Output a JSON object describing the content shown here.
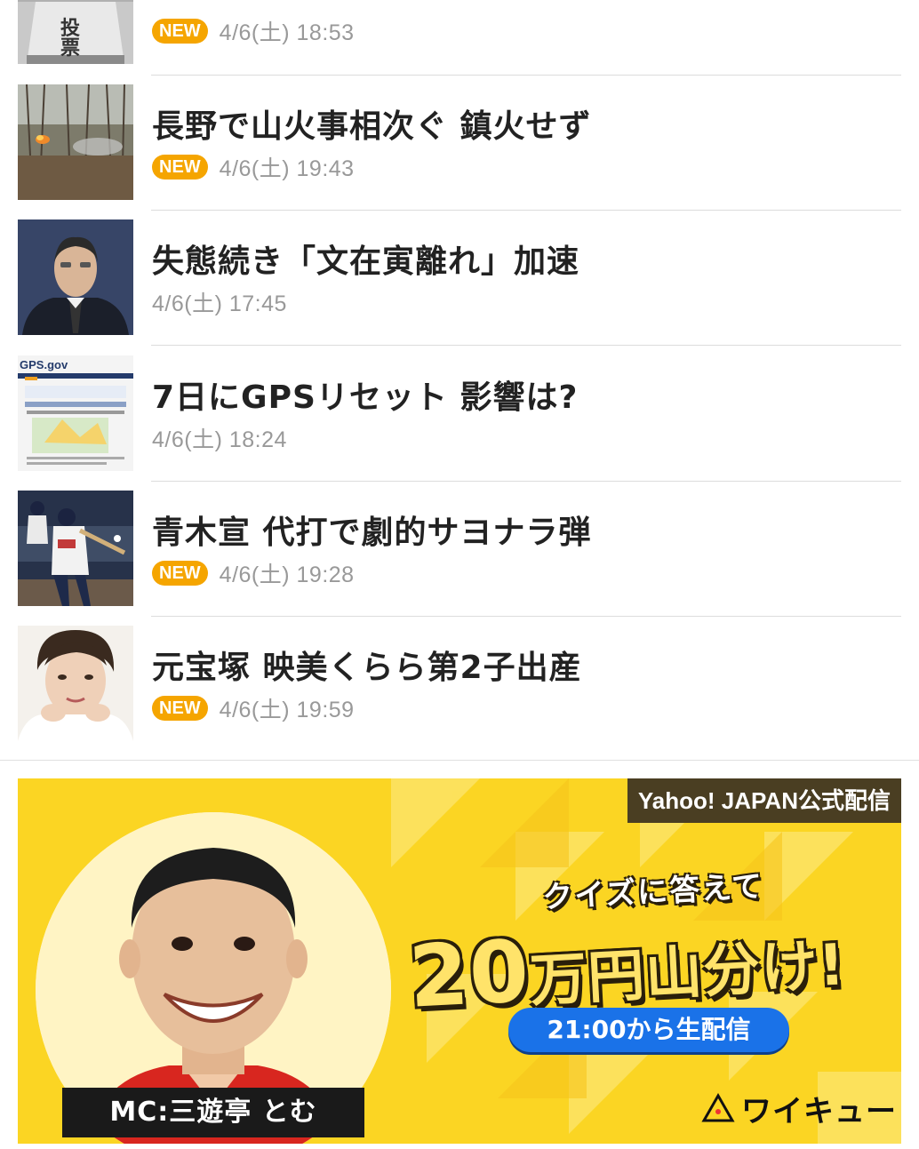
{
  "news": [
    {
      "title": "",
      "badge": "NEW",
      "date": "4/6(土) 18:53",
      "thumb_icon": "ballot-box-icon",
      "thumb_text": "投票"
    },
    {
      "title": "長野で山火事相次ぐ 鎮火せず",
      "badge": "NEW",
      "date": "4/6(土) 19:43",
      "thumb_icon": "wildfire-photo"
    },
    {
      "title": "失態続き「文在寅離れ」加速",
      "badge": "",
      "date": "4/6(土) 17:45",
      "thumb_icon": "politician-photo"
    },
    {
      "title": "7日にGPSリセット 影響は?",
      "badge": "",
      "date": "4/6(土) 18:24",
      "thumb_icon": "gps-website-screenshot",
      "thumb_text": "GPS.gov"
    },
    {
      "title": "青木宣 代打で劇的サヨナラ弾",
      "badge": "NEW",
      "date": "4/6(土) 19:28",
      "thumb_icon": "baseball-photo"
    },
    {
      "title": "元宝塚 映美くらら第2子出産",
      "badge": "NEW",
      "date": "4/6(土) 19:59",
      "thumb_icon": "actress-portrait-photo"
    }
  ],
  "ad": {
    "tag": "Yahoo! JAPAN公式配信",
    "line1": "クイズに答えて",
    "main_big": "20",
    "main_rest": "万円山分け!",
    "live": "21:00から生配信",
    "mc": "MC:三遊亭 とむ",
    "logo": "ワイキュー",
    "colors": {
      "background": "#fbd523",
      "pill": "#1a72e8",
      "tag": "#4a3e22",
      "badge": "#f5a500"
    }
  }
}
